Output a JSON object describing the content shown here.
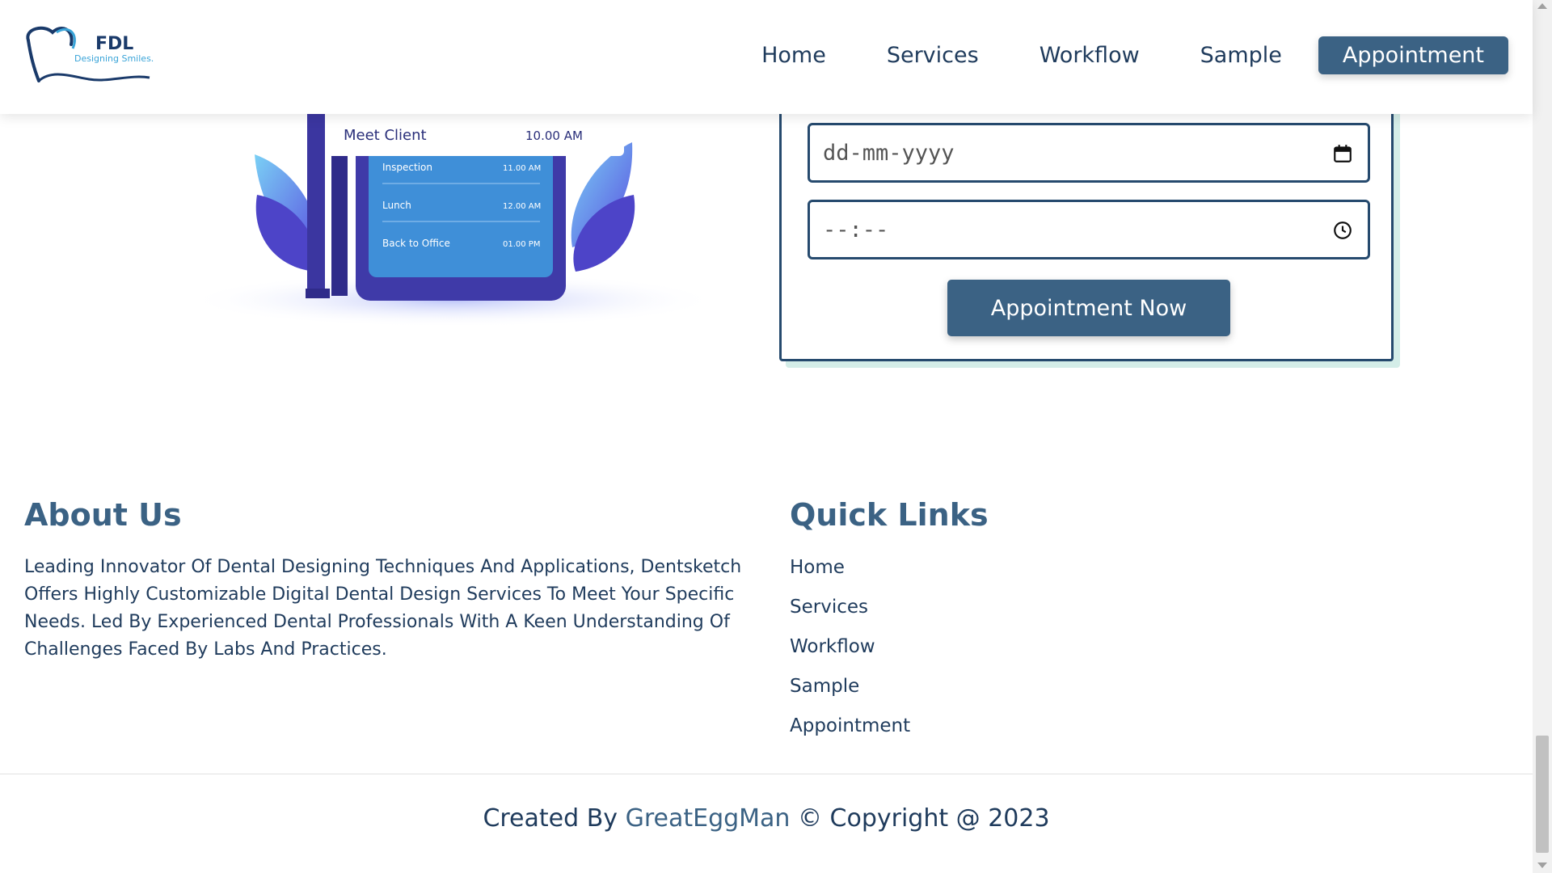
{
  "brand": {
    "name": "FDL",
    "tagline": "Designing Smiles."
  },
  "nav": {
    "items": [
      "Home",
      "Services",
      "Workflow",
      "Sample"
    ],
    "cta": "Appointment"
  },
  "illustration": {
    "header_item": "Meet Client",
    "header_time": "10.00 AM",
    "schedule": [
      {
        "label": "Inspection",
        "time": "11.00 AM"
      },
      {
        "label": "Lunch",
        "time": "12.00 AM"
      },
      {
        "label": "Back to Office",
        "time": "01.00 PM"
      }
    ]
  },
  "form": {
    "date_placeholder": "dd-mm-yyyy",
    "time_placeholder": "--:--",
    "submit_label": "Appointment Now"
  },
  "about": {
    "title": "About Us",
    "text": "Leading Innovator Of Dental Designing Techniques And Applications, Dentsketch Offers Highly Customizable Digital Dental Design Services To Meet Your Specific Needs. Led By Experienced Dental Professionals With A Keen Understanding Of Challenges Faced By Labs And Practices."
  },
  "quick_links": {
    "title": "Quick Links",
    "items": [
      "Home",
      "Services",
      "Workflow",
      "Sample",
      "Appointment"
    ]
  },
  "footer": {
    "prefix": "Created By",
    "author": "GreatEggMan",
    "suffix": "© Copyright @ 2023"
  },
  "colors": {
    "primary": "#3b6284",
    "text": "#1f3b5c",
    "border": "#264a6e",
    "card_shadow": "#d4ede8"
  }
}
